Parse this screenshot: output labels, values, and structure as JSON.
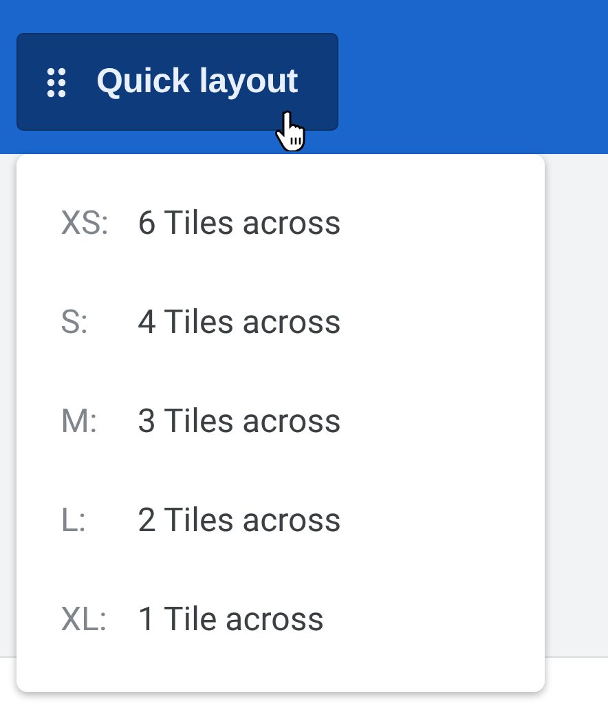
{
  "toolbar": {
    "button": {
      "label": "Quick layout"
    }
  },
  "menu": {
    "items": [
      {
        "size": "XS:",
        "label": "6 Tiles across"
      },
      {
        "size": "S:",
        "label": "4 Tiles across"
      },
      {
        "size": "M:",
        "label": "3 Tiles across"
      },
      {
        "size": "L:",
        "label": "2 Tiles across"
      },
      {
        "size": "XL:",
        "label": "1 Tile across"
      }
    ]
  }
}
